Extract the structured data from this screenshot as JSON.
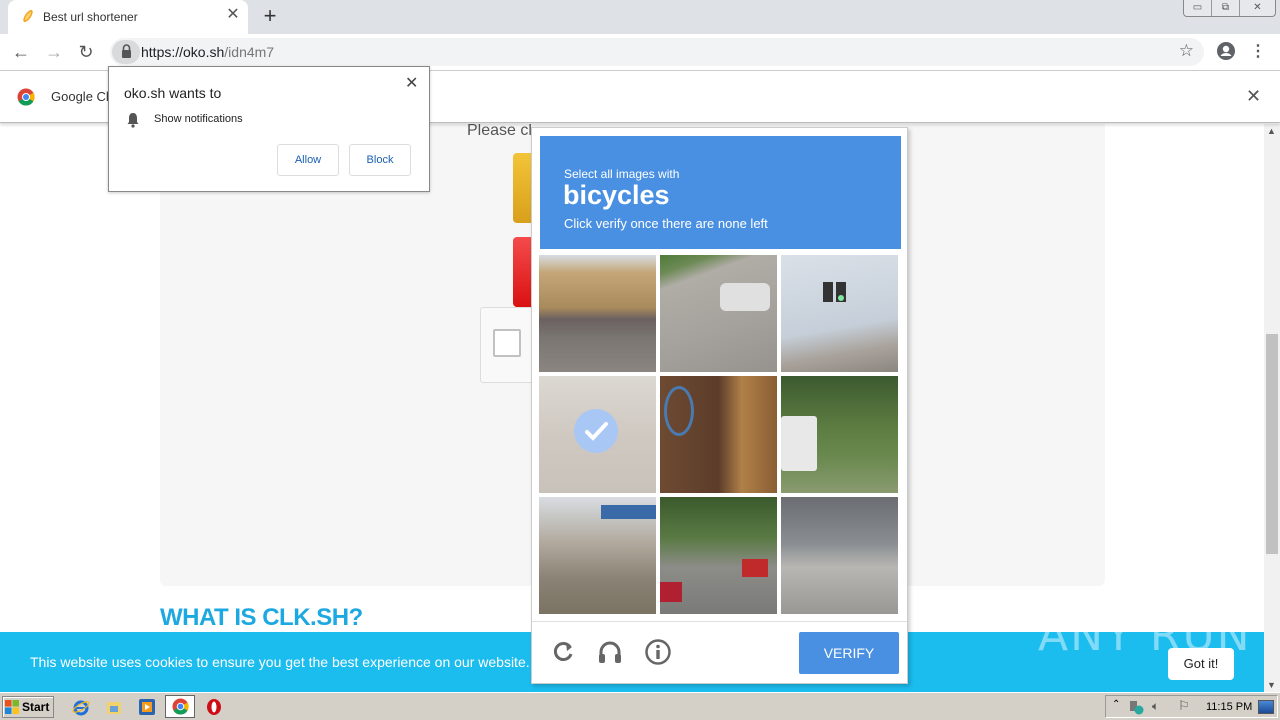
{
  "browser": {
    "tab_title": "Best url shortener",
    "url_host": "https://oko.sh",
    "url_path": "/idn4m7",
    "window_controls": [
      "minimize",
      "restore",
      "close"
    ]
  },
  "infobar": {
    "text": "Google Ch"
  },
  "notification_popup": {
    "title": "oko.sh wants to",
    "permission": "Show notifications",
    "allow_label": "Allow",
    "block_label": "Block"
  },
  "page": {
    "instruction": "Please cl",
    "section_heading": "WHAT IS CLK.SH?",
    "cookie_text": "This website uses cookies to ensure you get the best experience on our website. Le",
    "cookie_button": "Got it!",
    "watermark": "ANY RUN"
  },
  "captcha": {
    "prompt_line1": "Select all images with",
    "target": "bicycles",
    "prompt_line3": "Click verify once there are none left",
    "verify_label": "VERIFY",
    "tiles": [
      {
        "scene": "street-buildings-parked-cars",
        "selected": false
      },
      {
        "scene": "white-car-road",
        "selected": false
      },
      {
        "scene": "traffic-light-overpass",
        "selected": false
      },
      {
        "scene": "faded-street-bicycle",
        "selected": true
      },
      {
        "scene": "graffiti-wall",
        "selected": false
      },
      {
        "scene": "bus-trees",
        "selected": false
      },
      {
        "scene": "street-corner-traffic-light",
        "selected": false
      },
      {
        "scene": "tree-lined-street-cars",
        "selected": false
      },
      {
        "scene": "bridge-overpass",
        "selected": false
      }
    ]
  },
  "taskbar": {
    "start_label": "Start",
    "clock": "11:15 PM"
  },
  "colors": {
    "captcha_blue": "#4a90e2",
    "cookie_bar": "#1bbcee",
    "heading_blue": "#1ca8e0"
  }
}
